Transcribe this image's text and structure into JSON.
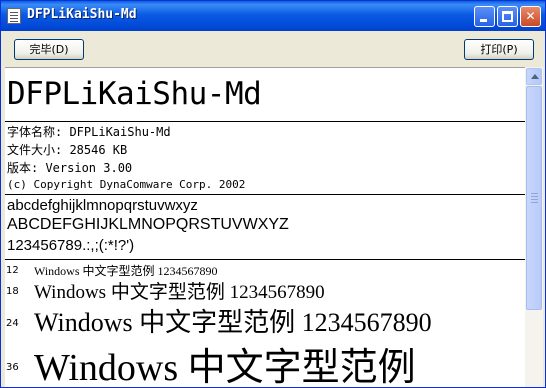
{
  "window": {
    "title": "DFPLiKaiShu-Md"
  },
  "toolbar": {
    "done_label": "完毕(D)",
    "print_label": "打印(P)"
  },
  "font": {
    "display_name": "DFPLiKaiShu-Md",
    "info": {
      "name_line": "字体名称: DFPLiKaiShu-Md",
      "size_line": "文件大小: 28546 KB",
      "version_line": "版本: Version 3.00",
      "copyright_line": "(c) Copyright DynaComware Corp. 2002"
    },
    "charset": {
      "lower": "abcdefghijklmnopqrstuvwxyz",
      "upper": "ABCDEFGHIJKLMNOPQRSTUVWXYZ",
      "digits": "123456789.:,;(:*!?')"
    },
    "samples": [
      {
        "size": "12",
        "text": "Windows 中文字型范例 1234567890"
      },
      {
        "size": "18",
        "text": "Windows 中文字型范例 1234567890"
      },
      {
        "size": "24",
        "text": "Windows 中文字型范例 1234567890"
      },
      {
        "size": "36",
        "text": "Windows 中文字型范例"
      }
    ]
  },
  "icons": [
    "app-document-icon",
    "minimize-icon",
    "maximize-icon",
    "close-icon"
  ]
}
